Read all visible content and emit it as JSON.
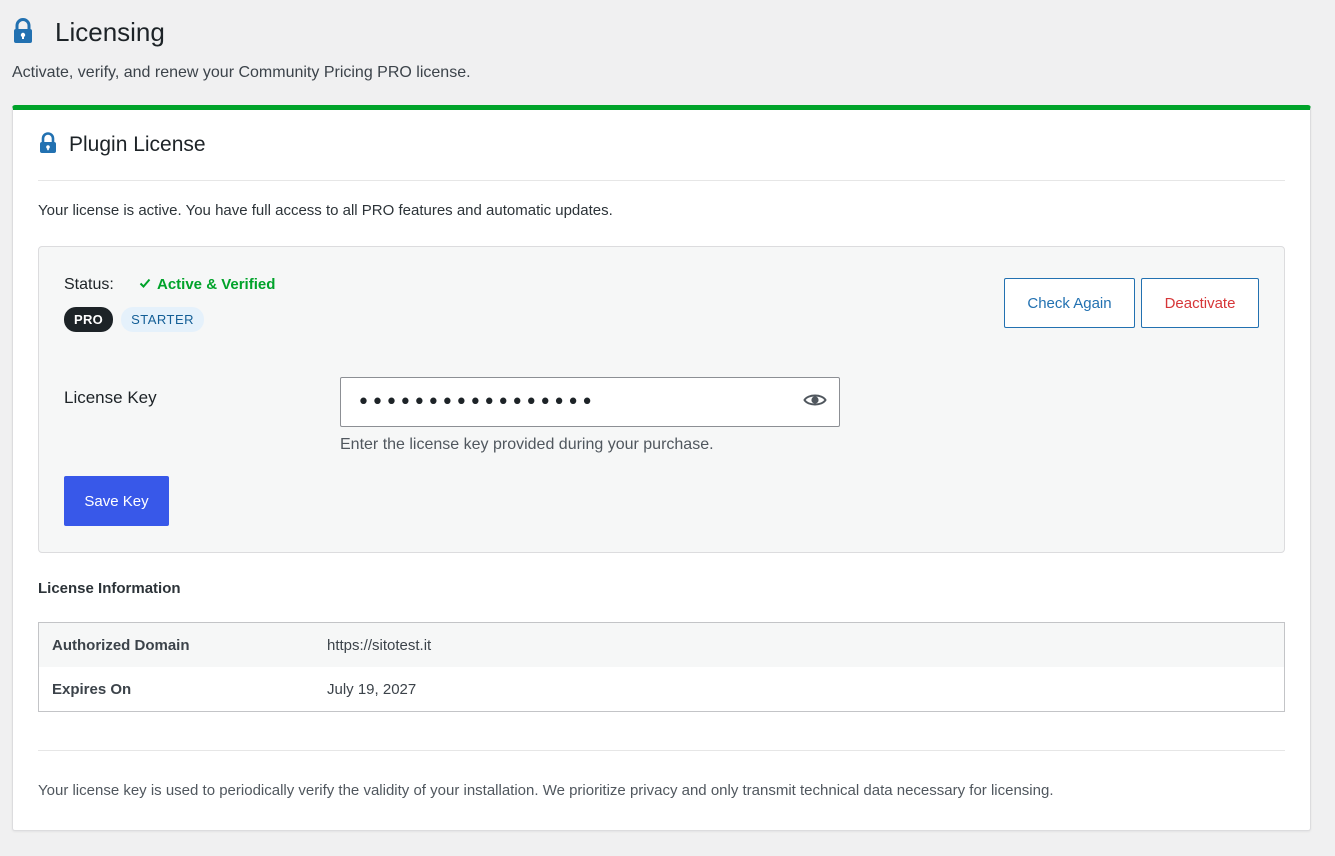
{
  "page": {
    "title": "Licensing",
    "description": "Activate, verify, and renew your Community Pricing PRO license.",
    "title_icon": "lock-icon"
  },
  "card": {
    "title": "Plugin License",
    "title_icon": "lock-icon",
    "accent_color": "#00a32a",
    "intro": "Your license is active. You have full access to all PRO features and automatic updates."
  },
  "status": {
    "label": "Status:",
    "value": "Active & Verified",
    "value_color": "#00a32a",
    "badges": [
      "PRO",
      "STARTER"
    ]
  },
  "actions": {
    "check_again": "Check Again",
    "deactivate": "Deactivate",
    "save_key": "Save Key"
  },
  "license_key": {
    "label": "License Key",
    "value": "•••••••••••••••••",
    "help": "Enter the license key provided during your purchase.",
    "toggle_icon": "eye-icon"
  },
  "info": {
    "title": "License Information",
    "rows": [
      {
        "key": "Authorized Domain",
        "value": "https://sitotest.it"
      },
      {
        "key": "Expires On",
        "value": "July 19, 2027"
      }
    ]
  },
  "footer": {
    "note": "Your license key is used to periodically verify the validity of your installation. We prioritize privacy and only transmit technical data necessary for licensing."
  }
}
